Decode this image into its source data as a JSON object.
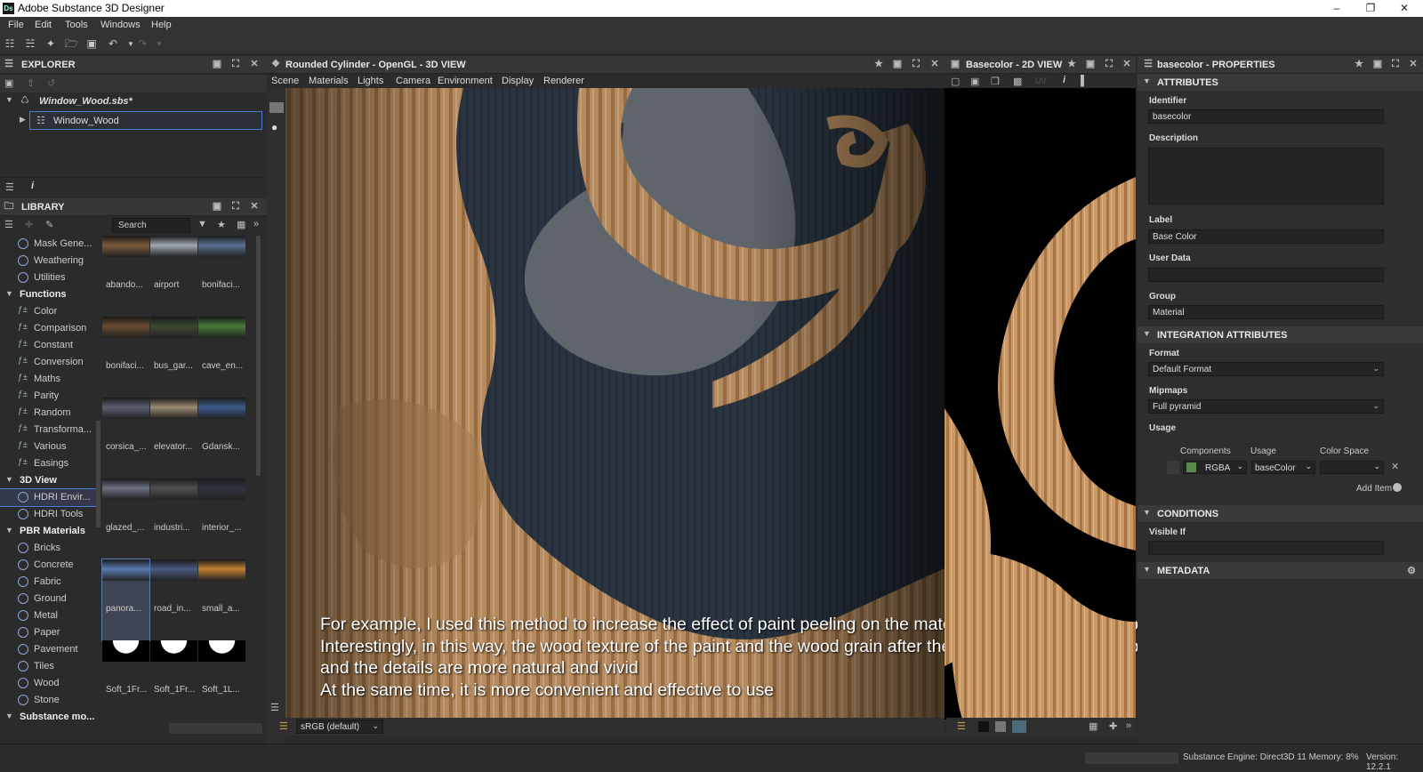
{
  "window": {
    "title": "Adobe Substance 3D Designer",
    "logo": "Ds"
  },
  "menu": [
    "File",
    "Edit",
    "Tools",
    "Windows",
    "Help"
  ],
  "explorer": {
    "title": "EXPLORER",
    "package": "Window_Wood.sbs*",
    "graph": "Window_Wood"
  },
  "library": {
    "title": "LIBRARY",
    "search_placeholder": "Search",
    "items": [
      {
        "label": "Mask Gene...",
        "kind": "item"
      },
      {
        "label": "Weathering",
        "kind": "item"
      },
      {
        "label": "Utilities",
        "kind": "item"
      },
      {
        "label": "Functions",
        "kind": "category"
      },
      {
        "label": "Color",
        "kind": "fx"
      },
      {
        "label": "Comparison",
        "kind": "fx"
      },
      {
        "label": "Constant",
        "kind": "fx"
      },
      {
        "label": "Conversion",
        "kind": "fx"
      },
      {
        "label": "Maths",
        "kind": "fx"
      },
      {
        "label": "Parity",
        "kind": "fx"
      },
      {
        "label": "Random",
        "kind": "fx"
      },
      {
        "label": "Transforma...",
        "kind": "fx"
      },
      {
        "label": "Various",
        "kind": "fx"
      },
      {
        "label": "Easings",
        "kind": "fx"
      },
      {
        "label": "3D View",
        "kind": "category"
      },
      {
        "label": "HDRI Envir...",
        "kind": "item",
        "selected": true
      },
      {
        "label": "HDRI Tools",
        "kind": "item"
      },
      {
        "label": "PBR Materials",
        "kind": "category"
      },
      {
        "label": "Bricks",
        "kind": "item"
      },
      {
        "label": "Concrete",
        "kind": "item"
      },
      {
        "label": "Fabric",
        "kind": "item"
      },
      {
        "label": "Ground",
        "kind": "item"
      },
      {
        "label": "Metal",
        "kind": "item"
      },
      {
        "label": "Paper",
        "kind": "item"
      },
      {
        "label": "Pavement",
        "kind": "item"
      },
      {
        "label": "Tiles",
        "kind": "item"
      },
      {
        "label": "Wood",
        "kind": "item"
      },
      {
        "label": "Stone",
        "kind": "item"
      },
      {
        "label": "Substance mo...",
        "kind": "category"
      }
    ],
    "thumbnails": [
      [
        "abando...",
        "airport",
        "bonifaci..."
      ],
      [
        "bonifaci...",
        "bus_gar...",
        "cave_en..."
      ],
      [
        "corsica_...",
        "elevator...",
        "Gdansk..."
      ],
      [
        "glazed_...",
        "industri...",
        "interior_..."
      ],
      [
        "panora...",
        "road_in...",
        "small_a..."
      ],
      [
        "Soft_1Fr...",
        "Soft_1Fr...",
        "Soft_1L..."
      ]
    ]
  },
  "view3d": {
    "title": "Rounded Cylinder - OpenGL - 3D VIEW",
    "tabs": [
      "Scene",
      "Materials",
      "Lights",
      "Camera",
      "Environment",
      "Display",
      "Renderer"
    ],
    "colorspace": "sRGB (default)"
  },
  "view2d": {
    "title": "Basecolor - 2D VIEW",
    "uv_label": "UV"
  },
  "properties": {
    "title": "basecolor - PROPERTIES",
    "sections": {
      "attributes": "ATTRIBUTES",
      "integration": "INTEGRATION ATTRIBUTES",
      "conditions": "CONDITIONS",
      "metadata": "METADATA"
    },
    "identifier_label": "Identifier",
    "identifier": "basecolor",
    "description_label": "Description",
    "description": "",
    "label_label": "Label",
    "label": "Base Color",
    "userdata_label": "User Data",
    "userdata": "",
    "group_label": "Group",
    "group": "Material",
    "format_label": "Format",
    "format": "Default Format",
    "mipmaps_label": "Mipmaps",
    "mipmaps": "Full pyramid",
    "usage_label": "Usage",
    "usage_cols": [
      "Components",
      "Usage",
      "Color Space"
    ],
    "usage_row": {
      "components": "RGBA",
      "usage": "baseColor",
      "colorspace": ""
    },
    "add_item": "Add Item",
    "visible_if_label": "Visible If",
    "visible_if": ""
  },
  "subtitles": [
    "For example, I used this method to increase the effect of paint peeling on the material of windows I made before",
    "Interestingly, in this way, the wood texture of the paint and the wood grain after the paint is peeled off completely match,",
    "and the details are more natural and vivid",
    "At the same time, it is more convenient and effective to use"
  ],
  "status": {
    "engine": "Substance Engine: Direct3D 11  Memory: 8%",
    "version": "Version: 12.2.1"
  },
  "colors": {
    "selection": "#4a7dd1",
    "wood": "#c89a6a",
    "paint": "#2a3440"
  }
}
